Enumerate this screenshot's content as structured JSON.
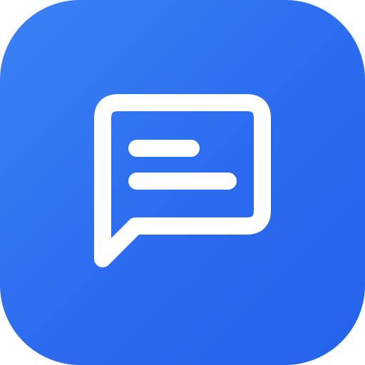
{
  "app_icon": {
    "icon": "chat-bubble-icon",
    "background_colors": [
      "#3A82F6",
      "#2563EB"
    ],
    "glyph_color": "#FFFFFF"
  }
}
